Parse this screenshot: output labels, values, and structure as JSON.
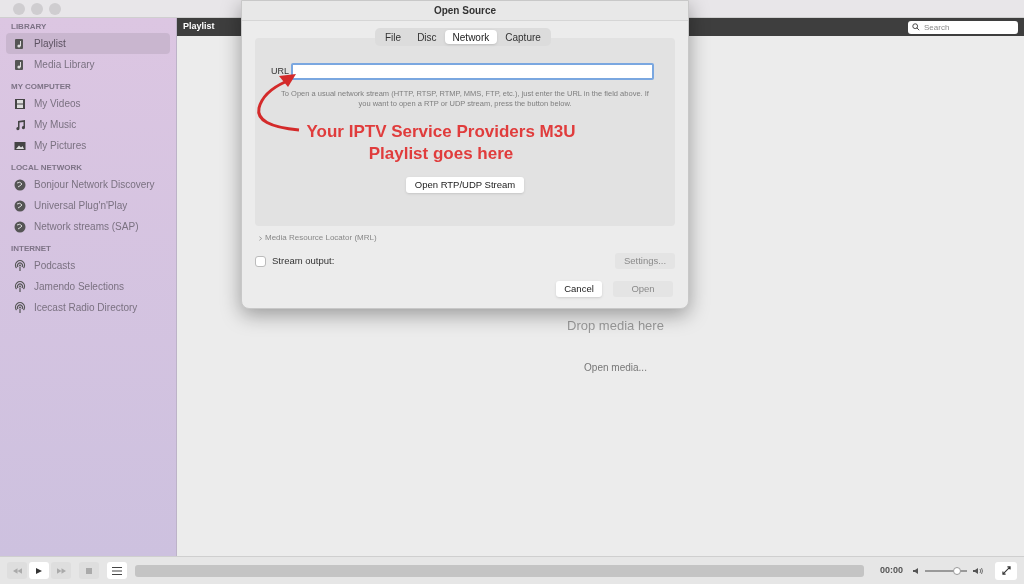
{
  "sidebar": {
    "sections": [
      {
        "title": "LIBRARY",
        "items": [
          {
            "label": "Playlist",
            "kind": "playlist",
            "selected": true
          },
          {
            "label": "Media Library",
            "kind": "playlist",
            "selected": false
          }
        ]
      },
      {
        "title": "MY COMPUTER",
        "items": [
          {
            "label": "My Videos",
            "kind": "video",
            "selected": false
          },
          {
            "label": "My Music",
            "kind": "music",
            "selected": false
          },
          {
            "label": "My Pictures",
            "kind": "picture",
            "selected": false
          }
        ]
      },
      {
        "title": "LOCAL NETWORK",
        "items": [
          {
            "label": "Bonjour Network Discovery",
            "kind": "network",
            "selected": false
          },
          {
            "label": "Universal Plug'n'Play",
            "kind": "network",
            "selected": false
          },
          {
            "label": "Network streams (SAP)",
            "kind": "network",
            "selected": false
          }
        ]
      },
      {
        "title": "INTERNET",
        "items": [
          {
            "label": "Podcasts",
            "kind": "podcast",
            "selected": false
          },
          {
            "label": "Jamendo Selections",
            "kind": "podcast",
            "selected": false
          },
          {
            "label": "Icecast Radio Directory",
            "kind": "podcast",
            "selected": false
          }
        ]
      }
    ]
  },
  "playlist": {
    "title": "Playlist",
    "search_placeholder": "Search",
    "drop_text": "Drop media here",
    "open_media": "Open media..."
  },
  "dialog": {
    "title": "Open Source",
    "tabs": [
      {
        "label": "File",
        "selected": false
      },
      {
        "label": "Disc",
        "selected": false
      },
      {
        "label": "Network",
        "selected": true
      },
      {
        "label": "Capture",
        "selected": false
      }
    ],
    "url_label": "URL",
    "help_text": "To Open a usual network stream (HTTP, RTSP, RTMP, MMS, FTP, etc.), just enter the URL in the field above. If you want to open a RTP or UDP stream, press the button below.",
    "rtp_button": "Open RTP/UDP Stream",
    "mrl_label": "Media Resource Locator (MRL)",
    "stream_output": {
      "label": "Stream output:",
      "checked": false
    },
    "settings_button": {
      "label": "Settings...",
      "disabled": true
    },
    "cancel_button": {
      "label": "Cancel",
      "disabled": false
    },
    "open_button": {
      "label": "Open",
      "disabled": true
    }
  },
  "annotation": {
    "text": "Your IPTV Service Providers M3U Playlist goes here"
  },
  "controls": {
    "time": "00:00",
    "volume": {
      "level": 0.75
    }
  }
}
